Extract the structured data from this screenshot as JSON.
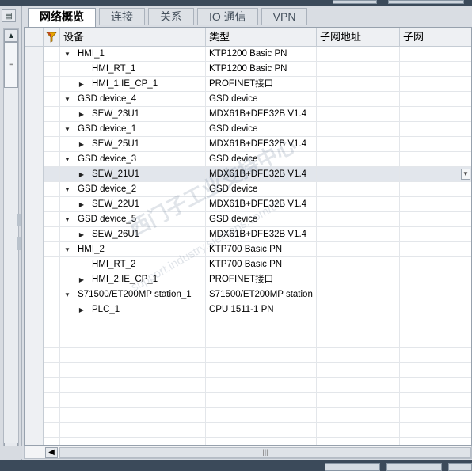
{
  "tabs": [
    {
      "label": "网络概览",
      "active": true
    },
    {
      "label": "连接",
      "active": false
    },
    {
      "label": "关系",
      "active": false
    },
    {
      "label": "IO 通信",
      "active": false
    },
    {
      "label": "VPN",
      "active": false
    }
  ],
  "columns": {
    "device": "设备",
    "type": "类型",
    "subnet_address": "子网地址",
    "subnet": "子网"
  },
  "rows": [
    {
      "level": 1,
      "expand": "down",
      "device": "HMI_1",
      "type": "KTP1200 Basic PN"
    },
    {
      "level": 2,
      "expand": "none",
      "device": "HMI_RT_1",
      "type": "KTP1200 Basic PN"
    },
    {
      "level": 2,
      "expand": "right",
      "device": "HMI_1.IE_CP_1",
      "type": "PROFINET接口"
    },
    {
      "level": 1,
      "expand": "down",
      "device": "GSD device_4",
      "type": "GSD device"
    },
    {
      "level": 2,
      "expand": "right",
      "device": "SEW_23U1",
      "type": "MDX61B+DFE32B V1.4"
    },
    {
      "level": 1,
      "expand": "down",
      "device": "GSD device_1",
      "type": "GSD device"
    },
    {
      "level": 2,
      "expand": "right",
      "device": "SEW_25U1",
      "type": "MDX61B+DFE32B V1.4"
    },
    {
      "level": 1,
      "expand": "down",
      "device": "GSD device_3",
      "type": "GSD device"
    },
    {
      "level": 2,
      "expand": "right",
      "device": "SEW_21U1",
      "type": "MDX61B+DFE32B V1.4",
      "selected": true
    },
    {
      "level": 1,
      "expand": "down",
      "device": "GSD device_2",
      "type": "GSD device"
    },
    {
      "level": 2,
      "expand": "right",
      "device": "SEW_22U1",
      "type": "MDX61B+DFE32B V1.4"
    },
    {
      "level": 1,
      "expand": "down",
      "device": "GSD device_5",
      "type": "GSD device"
    },
    {
      "level": 2,
      "expand": "right",
      "device": "SEW_26U1",
      "type": "MDX61B+DFE32B V1.4"
    },
    {
      "level": 1,
      "expand": "down",
      "device": "HMI_2",
      "type": "KTP700 Basic PN"
    },
    {
      "level": 2,
      "expand": "none",
      "device": "HMI_RT_2",
      "type": "KTP700 Basic PN"
    },
    {
      "level": 2,
      "expand": "right",
      "device": "HMI_2.IE_CP_1",
      "type": "PROFINET接口"
    },
    {
      "level": 1,
      "expand": "down",
      "device": "S71500/ET200MP station_1",
      "type": "S71500/ET200MP station"
    },
    {
      "level": 2,
      "expand": "right",
      "device": "PLC_1",
      "type": "CPU 1511-1 PN"
    }
  ],
  "empty_rows": 9,
  "watermark": {
    "line1": "西门子工业支持中心",
    "line2": "support.industry.siemens.com/cs"
  },
  "icons": {
    "filter": "filter-icon",
    "expand": "triangle-down-icon",
    "collapse": "triangle-right-icon"
  },
  "colors": {
    "selected_row": "#e2e6ec",
    "active_tab": "#ffffff",
    "header": "#eef0f3"
  }
}
